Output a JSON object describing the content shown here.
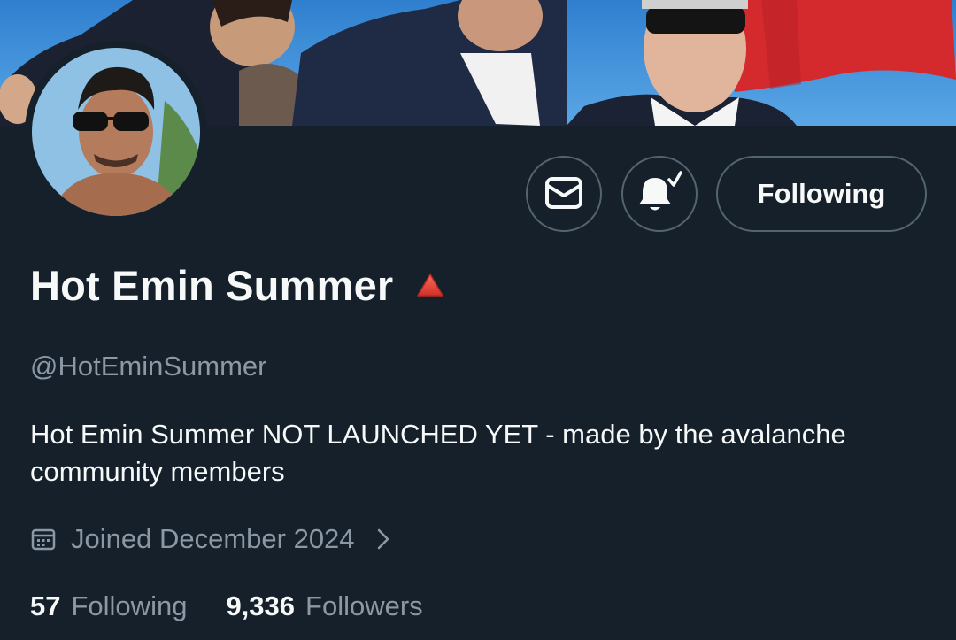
{
  "profile": {
    "display_name": "Hot Emin Summer",
    "handle": "@HotEminSummer",
    "bio": "Hot Emin Summer NOT LAUNCHED YET - made by the avalanche community members",
    "joined": "Joined December 2024"
  },
  "actions": {
    "follow_label": "Following",
    "message_icon": "envelope-icon",
    "notify_icon": "bell-check-icon"
  },
  "stats": {
    "following_count": "57",
    "following_label": "Following",
    "followers_count": "9,336",
    "followers_label": "Followers"
  },
  "colors": {
    "background": "#15202b",
    "text_primary": "#f7f9f9",
    "text_secondary": "#8b98a5",
    "border": "#536471",
    "badge_red": "#e0443a"
  }
}
